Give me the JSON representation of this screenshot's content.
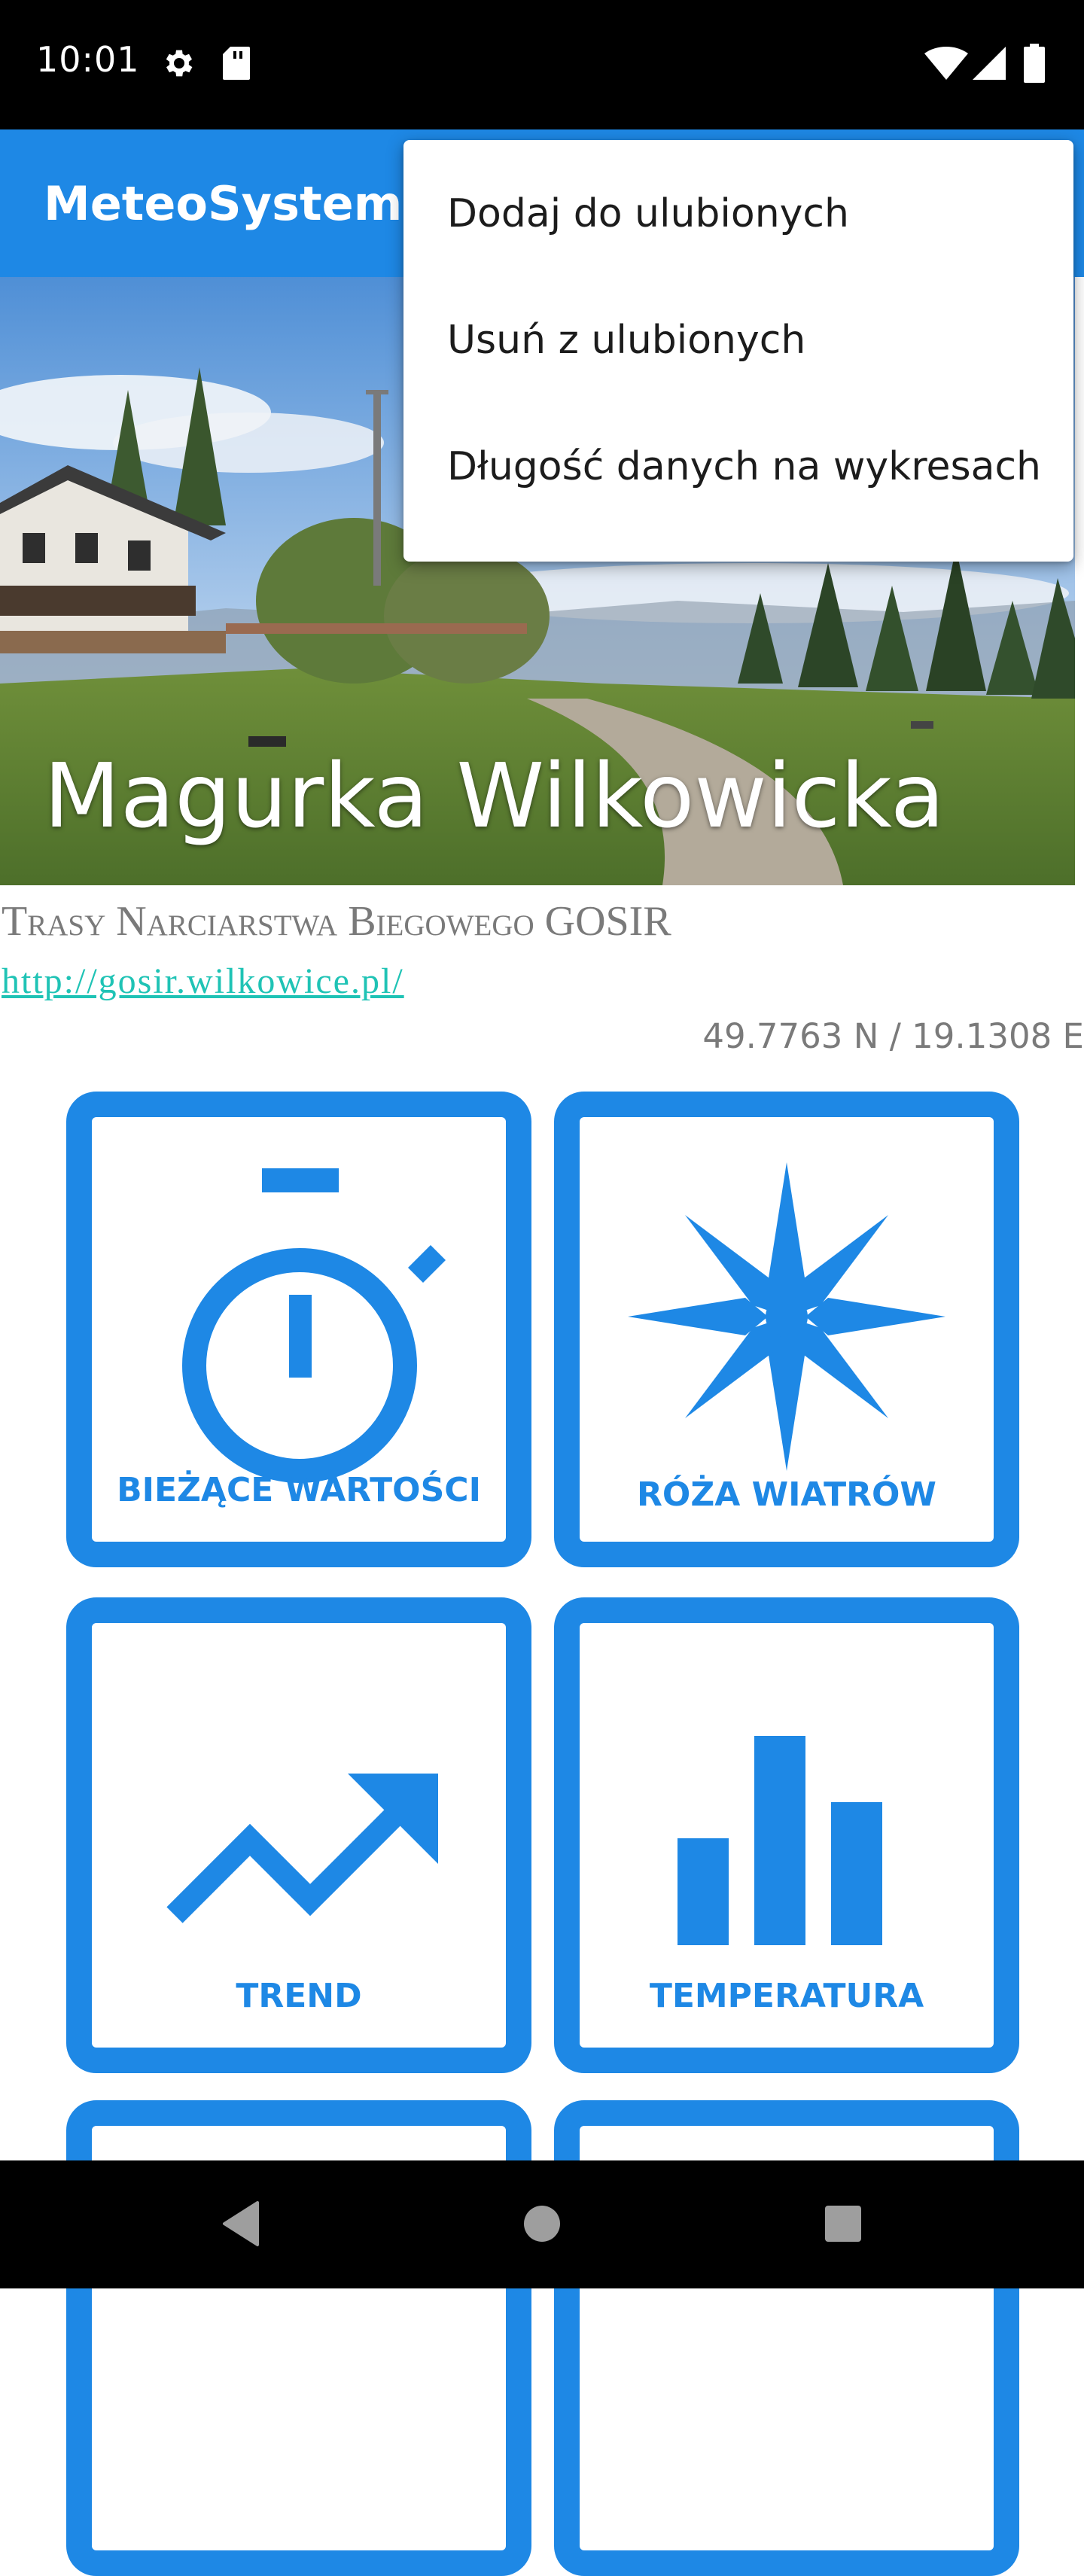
{
  "status_bar": {
    "time": "10:01",
    "left_icons": [
      "gear-icon",
      "sd-card-icon"
    ],
    "right_icons": [
      "wifi-icon",
      "signal-icon",
      "battery-icon"
    ]
  },
  "app_bar": {
    "title": "MeteoSystem"
  },
  "overflow_menu": {
    "items": [
      "Dodaj do ulubionych",
      "Usuń z ulubionych",
      "Długość danych na wykresach"
    ]
  },
  "station": {
    "name": "Magurka Wilkowicka",
    "description": "Trasy Narciarstwa Biegowego GOSIR",
    "url": "http://gosir.wilkowice.pl/",
    "coordinates": "49.7763 N / 19.1308 E"
  },
  "tiles": [
    {
      "label": "BIEŻĄCE WARTOŚCI",
      "icon": "stopwatch-icon"
    },
    {
      "label": "RÓŻA WIATRÓW",
      "icon": "compass-rose-icon"
    },
    {
      "label": "TREND",
      "icon": "trending-up-icon"
    },
    {
      "label": "TEMPERATURA",
      "icon": "bar-chart-icon"
    }
  ],
  "nav_bar": {
    "buttons": [
      "back-icon",
      "home-icon",
      "recents-icon"
    ]
  },
  "colors": {
    "primary": "#1e88e5",
    "link": "#1fc3b5",
    "muted_text": "#7a7a7a",
    "system_bars": "#000000"
  }
}
